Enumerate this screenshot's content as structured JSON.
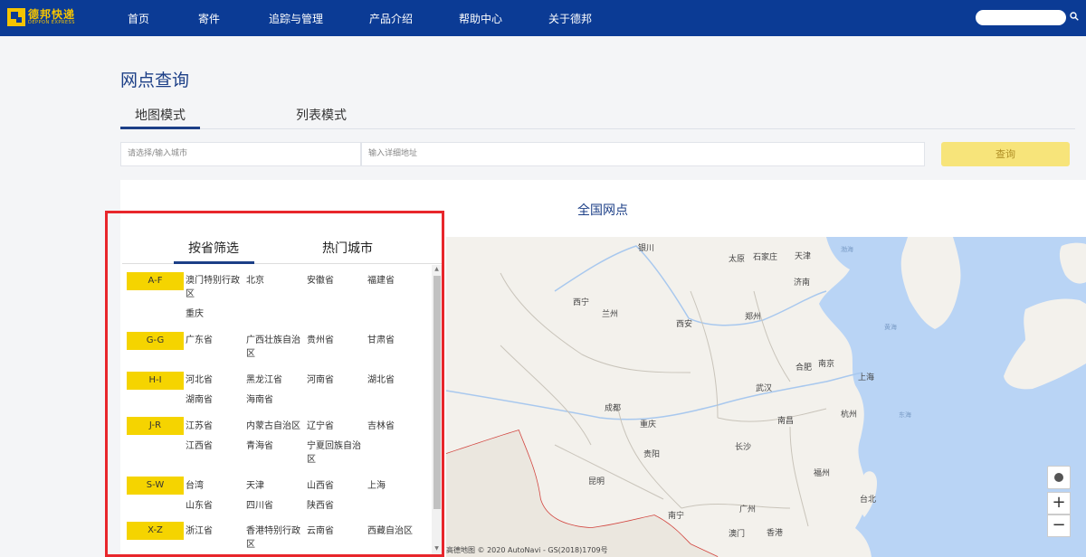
{
  "brand": {
    "name_cn": "德邦快递",
    "name_en": "DEPPON EXPRESS",
    "color": "#f5c400"
  },
  "nav": {
    "items": [
      "首页",
      "寄件",
      "追踪与管理",
      "产品介绍",
      "帮助中心",
      "关于德邦"
    ],
    "search_placeholder": "",
    "background": "#0b3b95"
  },
  "page": {
    "title": "网点查询",
    "tabs": [
      "地图模式",
      "列表模式"
    ],
    "active_tab": "地图模式"
  },
  "search": {
    "city_placeholder": "请选择/输入城市",
    "address_placeholder": "输入详细地址",
    "query_label": "查询"
  },
  "map": {
    "heading": "全国网点",
    "copyright": "高德地图 © 2020 AutoNavi - GS(2018)1709号",
    "zoom_in": "+",
    "zoom_out": "−",
    "cities": [
      "银川",
      "太原",
      "石家庄",
      "天津",
      "渤海",
      "西宁",
      "兰州",
      "济南",
      "西安",
      "郑州",
      "黄海",
      "合肥",
      "南京",
      "上海",
      "武汉",
      "杭州",
      "成都",
      "重庆",
      "南昌",
      "东海",
      "贵阳",
      "长沙",
      "福州",
      "昆明",
      "台北",
      "南宁",
      "广州",
      "澳门",
      "香港"
    ]
  },
  "filter": {
    "tabs": [
      "按省筛选",
      "热门城市"
    ],
    "active_tab": "按省筛选",
    "groups": [
      {
        "label": "A-F",
        "provinces": [
          "澳门特别行政区",
          "北京",
          "安徽省",
          "福建省",
          "重庆"
        ]
      },
      {
        "label": "G-G",
        "provinces": [
          "广东省",
          "广西壮族自治区",
          "贵州省",
          "甘肃省"
        ]
      },
      {
        "label": "H-I",
        "provinces": [
          "河北省",
          "黑龙江省",
          "河南省",
          "湖北省",
          "湖南省",
          "海南省"
        ]
      },
      {
        "label": "J-R",
        "provinces": [
          "江苏省",
          "内蒙古自治区",
          "辽宁省",
          "吉林省",
          "江西省",
          "青海省",
          "宁夏回族自治区"
        ]
      },
      {
        "label": "S-W",
        "provinces": [
          "台湾",
          "天津",
          "山西省",
          "上海",
          "山东省",
          "四川省",
          "陕西省"
        ]
      },
      {
        "label": "X-Z",
        "provinces": [
          "浙江省",
          "香港特别行政区",
          "云南省",
          "西藏自治区"
        ]
      }
    ]
  }
}
